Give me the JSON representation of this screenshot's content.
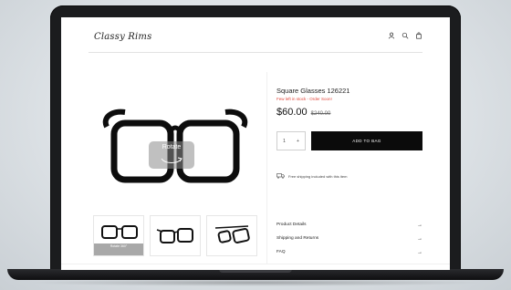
{
  "site": {
    "logo": "Classy Rims"
  },
  "header": {
    "icons": [
      "account-icon",
      "search-icon",
      "bag-icon"
    ]
  },
  "gallery": {
    "rotate_label": "Rotate",
    "thumbnails": [
      {
        "label": "Rotate 360°"
      },
      {
        "label": ""
      },
      {
        "label": ""
      }
    ]
  },
  "product": {
    "title": "Square Glasses 126221",
    "stock_note": "Few left in stock - Order Soon!",
    "price": "$60.00",
    "old_price": "$240.00",
    "quantity": "1",
    "qty_plus": "+",
    "add_to_bag": "ADD TO BAG",
    "shipping_note": "Free shipping included with this item"
  },
  "accordion": {
    "items": [
      {
        "label": "Product Details",
        "arrow": "→"
      },
      {
        "label": "Shipping and Returns",
        "arrow": "→"
      },
      {
        "label": "FAQ",
        "arrow": "→"
      }
    ]
  },
  "colors": {
    "accent_red": "#e0453a",
    "button": "#0b0b0b"
  }
}
